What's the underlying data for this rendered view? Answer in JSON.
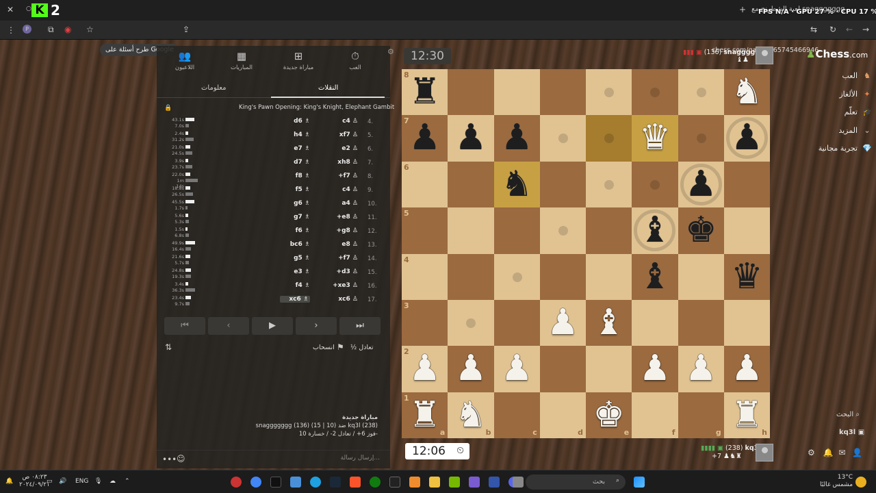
{
  "browser": {
    "tab_title": "لعبة الشطرنج مع snaggggggg",
    "overlay_stats": "FPS N/A · GPU 27 % · CPU 17 %",
    "google_chip": "طرح أسئلة على Google",
    "url": "chess.com/game/165745466946"
  },
  "panel": {
    "tabs": {
      "play": "العب",
      "new_game": "مباراة جديدة",
      "games": "المباريات",
      "players": "اللاعبون"
    },
    "subtabs": {
      "moves": "النقلات",
      "info": "معلومات"
    },
    "opening": "King's Pawn Opening: King's Knight, Elephant Gambit",
    "moves": [
      {
        "num": "4.",
        "white": "c4",
        "black": "d6"
      },
      {
        "num": "5.",
        "white": "xf7",
        "black": "h4"
      },
      {
        "num": "6.",
        "white": "e2",
        "black": "e7"
      },
      {
        "num": "7.",
        "white": "xh8",
        "black": "d7"
      },
      {
        "num": "8.",
        "white": "+f7",
        "black": "f8"
      },
      {
        "num": "9.",
        "white": "c4",
        "black": "f5"
      },
      {
        "num": "10.",
        "white": "a4",
        "black": "g6"
      },
      {
        "num": "11.",
        "white": "+e8",
        "black": "g7"
      },
      {
        "num": "12.",
        "white": "+g8",
        "black": "f6"
      },
      {
        "num": "13.",
        "white": "e8",
        "black": "bc6"
      },
      {
        "num": "14.",
        "white": "+f7",
        "black": "g5"
      },
      {
        "num": "15.",
        "white": "+d3",
        "black": "e3"
      },
      {
        "num": "16.",
        "white": "+xe3",
        "black": "f4"
      },
      {
        "num": "17.",
        "white": "xc6",
        "black": "xc6"
      }
    ],
    "times": [
      {
        "w": "43.1s",
        "b": "7.0s",
        "wp": 0.9,
        "bp": 0.1
      },
      {
        "w": "2.4s",
        "b": "31.2s",
        "wp": 0.05,
        "bp": 0.6
      },
      {
        "w": "21.0s",
        "b": "24.5s",
        "wp": 0.4,
        "bp": 0.45
      },
      {
        "w": "3.9s",
        "b": "23.7s",
        "wp": 0.07,
        "bp": 0.45
      },
      {
        "w": "22.0s",
        "b": "1m 14s",
        "wp": 0.4,
        "bp": 1.0
      },
      {
        "w": "18.8s",
        "b": "26.5s",
        "wp": 0.35,
        "bp": 0.5
      },
      {
        "w": "45.5s",
        "b": "1.7s",
        "wp": 0.95,
        "bp": 0.03
      },
      {
        "w": "5.6s",
        "b": "5.3s",
        "wp": 0.1,
        "bp": 0.1
      },
      {
        "w": "1.5s",
        "b": "6.8s",
        "wp": 0.03,
        "bp": 0.13
      },
      {
        "w": "49.9s",
        "b": "16.4s",
        "wp": 1.0,
        "bp": 0.3
      },
      {
        "w": "21.6s",
        "b": "5.7s",
        "wp": 0.4,
        "bp": 0.1
      },
      {
        "w": "24.8s",
        "b": "19.3s",
        "wp": 0.45,
        "bp": 0.35
      },
      {
        "w": "3.4s",
        "b": "36.3s",
        "wp": 0.06,
        "bp": 0.7
      },
      {
        "w": "23.4s",
        "b": "9.7s",
        "wp": 0.45,
        "bp": 0.18
      }
    ],
    "nav": {
      "first": "⏮",
      "prev": "‹",
      "play": "▶",
      "next": "›",
      "last": "⏭"
    },
    "draw_label": "½ تعادل",
    "resign_label": "انسحاب",
    "game_info": {
      "line1": "مباراة جديدة",
      "line2": "snaggggggg (136) (15 | 10) ضد kq3l (238)",
      "line3": "فوز 6+ / تعادل 2- / خسارة 10-"
    },
    "chat_placeholder": "إرسال رسالة..."
  },
  "clocks": {
    "top": "12:30",
    "bottom": "12:06"
  },
  "players": {
    "top": {
      "name": "snaggggggg",
      "rating": "(136)"
    },
    "bottom": {
      "name": "kq3l",
      "rating": "(238)",
      "extra": "+7"
    }
  },
  "board": {
    "ranks": [
      "8",
      "7",
      "6",
      "5",
      "4",
      "3",
      "2",
      "1"
    ],
    "files": [
      "a",
      "b",
      "c",
      "d",
      "e",
      "f",
      "g",
      "h"
    ],
    "rows": [
      [
        "bR",
        "",
        "",
        "",
        "",
        "",
        "",
        "wN"
      ],
      [
        "bP",
        "bP",
        "bP",
        "",
        "",
        "wQ",
        "",
        "bP"
      ],
      [
        "",
        "",
        "bN",
        "",
        "",
        "",
        "bP",
        ""
      ],
      [
        "",
        "",
        "",
        "",
        "",
        "bB",
        "bK",
        ""
      ],
      [
        "",
        "",
        "",
        "",
        "",
        "bB",
        "",
        "bQ"
      ],
      [
        "",
        "",
        "",
        "wP",
        "wB",
        "",
        "",
        ""
      ],
      [
        "wP",
        "wP",
        "wP",
        "",
        "",
        "wP",
        "wP",
        "wP"
      ],
      [
        "wR",
        "wN",
        "",
        "",
        "wK",
        "",
        "",
        "wR"
      ]
    ],
    "highlights": [
      [
        1,
        4
      ],
      [
        1,
        5
      ],
      [
        2,
        2
      ]
    ],
    "dots": [
      [
        0,
        4
      ],
      [
        0,
        5
      ],
      [
        0,
        6
      ],
      [
        1,
        3
      ],
      [
        1,
        4
      ],
      [
        1,
        6
      ],
      [
        2,
        4
      ],
      [
        2,
        5
      ],
      [
        3,
        3
      ],
      [
        4,
        2
      ],
      [
        5,
        1
      ]
    ],
    "rings": [
      [
        1,
        7
      ],
      [
        2,
        6
      ],
      [
        3,
        5
      ]
    ]
  },
  "sidebar": {
    "brand": "Chess",
    "brand_suffix": ".com",
    "items": [
      {
        "label": "العب",
        "icon": "play-icon"
      },
      {
        "label": "الألغاز",
        "icon": "puzzle-icon"
      },
      {
        "label": "تعلّم",
        "icon": "learn-icon"
      },
      {
        "label": "المزيد",
        "icon": "chevron-down-icon"
      },
      {
        "label": "تجربة مجانية",
        "icon": "diamond-icon"
      }
    ],
    "search_label": "البحث",
    "user": "kq3l"
  },
  "taskbar": {
    "search_placeholder": "بحث",
    "lang": "ENG",
    "time": "٠٨:٢٣ ص",
    "date": "٢٠٢٤/٠٩/٢١",
    "weather_temp": "13°C",
    "weather_desc": "مشمس غالبًا"
  }
}
